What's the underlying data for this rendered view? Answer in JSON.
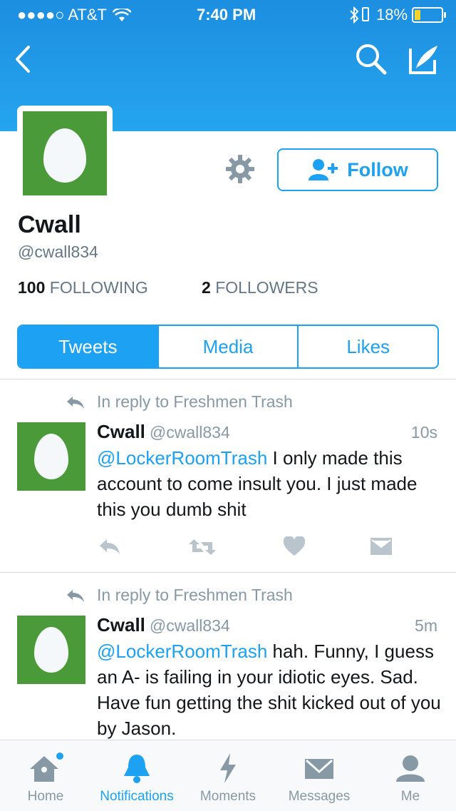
{
  "status_bar": {
    "carrier": "●●●●○ AT&T",
    "time": "7:40 PM",
    "battery": "18%"
  },
  "profile": {
    "name": "Cwall",
    "handle": "@cwall834",
    "following_count": "100",
    "following_label": "FOLLOWING",
    "followers_count": "2",
    "followers_label": "FOLLOWERS",
    "follow_label": "Follow"
  },
  "tabs": [
    {
      "label": "Tweets",
      "active": true
    },
    {
      "label": "Media",
      "active": false
    },
    {
      "label": "Likes",
      "active": false
    }
  ],
  "tweets": [
    {
      "reply_context": "In reply to Freshmen Trash",
      "name": "Cwall",
      "handle": "@cwall834",
      "time": "10s",
      "mention": "@LockerRoomTrash",
      "text": " I only made this account to come insult you. I just made this you dumb shit"
    },
    {
      "reply_context": "In reply to Freshmen Trash",
      "name": "Cwall",
      "handle": "@cwall834",
      "time": "5m",
      "mention": "@LockerRoomTrash",
      "text": " hah. Funny, I guess an A- is failing in your idiotic eyes. Sad. Have fun getting the shit kicked out of you by Jason."
    }
  ],
  "tab_bar": [
    {
      "label": "Home",
      "icon": "home-icon"
    },
    {
      "label": "Notifications",
      "icon": "bell-icon",
      "active": true
    },
    {
      "label": "Moments",
      "icon": "lightning-icon"
    },
    {
      "label": "Messages",
      "icon": "envelope-icon"
    },
    {
      "label": "Me",
      "icon": "person-icon"
    }
  ],
  "colors": {
    "accent": "#1da1f2",
    "header": "#1d8ee0",
    "egg_bg": "#4a9a3a",
    "muted": "#8899a6"
  }
}
